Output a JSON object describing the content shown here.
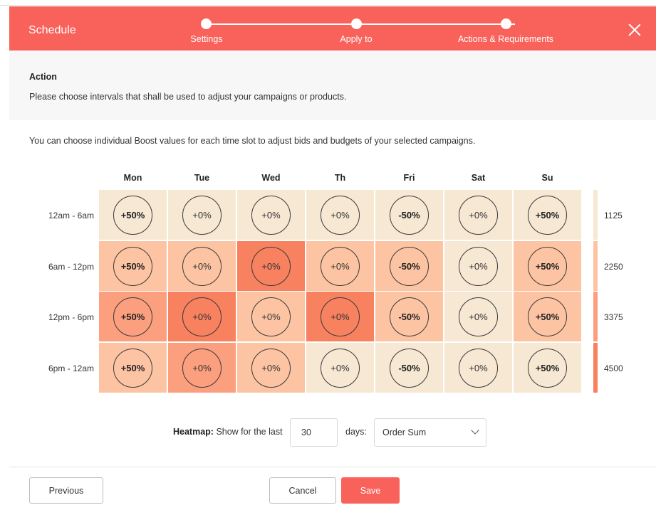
{
  "header": {
    "title": "Schedule",
    "steps": [
      {
        "label": "Settings"
      },
      {
        "label": "Apply to"
      },
      {
        "label": "Actions & Requirements"
      }
    ]
  },
  "action": {
    "title": "Action",
    "description": "Please choose intervals that shall be used to adjust your campaigns or products."
  },
  "intro": "You can choose individual Boost values for each time slot to adjust bids and budgets of your selected campaigns.",
  "schedule": {
    "days": [
      "Mon",
      "Tue",
      "Wed",
      "Th",
      "Fri",
      "Sat",
      "Su"
    ],
    "rows": [
      {
        "label": "12am - 6am",
        "cells": [
          "+50%",
          "+0%",
          "+0%",
          "+0%",
          "-50%",
          "+0%",
          "+50%"
        ]
      },
      {
        "label": "6am - 12pm",
        "cells": [
          "+50%",
          "+0%",
          "+0%",
          "+0%",
          "-50%",
          "+0%",
          "+50%"
        ]
      },
      {
        "label": "12pm - 6pm",
        "cells": [
          "+50%",
          "+0%",
          "+0%",
          "+0%",
          "-50%",
          "+0%",
          "+50%"
        ]
      },
      {
        "label": "6pm - 12am",
        "cells": [
          "+50%",
          "+0%",
          "+0%",
          "+0%",
          "-50%",
          "+0%",
          "+50%"
        ]
      }
    ],
    "heat_levels": [
      [
        0,
        0,
        0,
        0,
        0,
        0,
        0
      ],
      [
        1,
        1,
        3,
        1,
        1,
        0,
        1
      ],
      [
        2,
        3,
        1,
        3,
        1,
        0,
        1
      ],
      [
        1,
        2,
        1,
        0,
        0,
        0,
        0
      ]
    ],
    "heat_colors": [
      "#f6e8d3",
      "#fdc4a3",
      "#fb9f7f",
      "#f8815f"
    ]
  },
  "legend": {
    "values": [
      "1125",
      "2250",
      "3375",
      "4500"
    ],
    "colors": [
      "#f6e8d3",
      "#fdc4a3",
      "#fb9f7f",
      "#f8815f"
    ]
  },
  "heatmap_filter": {
    "label_bold": "Heatmap:",
    "label_rest": " Show for the last",
    "days_value": "30",
    "days_suffix": "days:",
    "metric_selected": "Order Sum"
  },
  "footer": {
    "previous_label": "Previous",
    "cancel_label": "Cancel",
    "save_label": "Save"
  },
  "colors": {
    "accent": "#f9625b"
  }
}
